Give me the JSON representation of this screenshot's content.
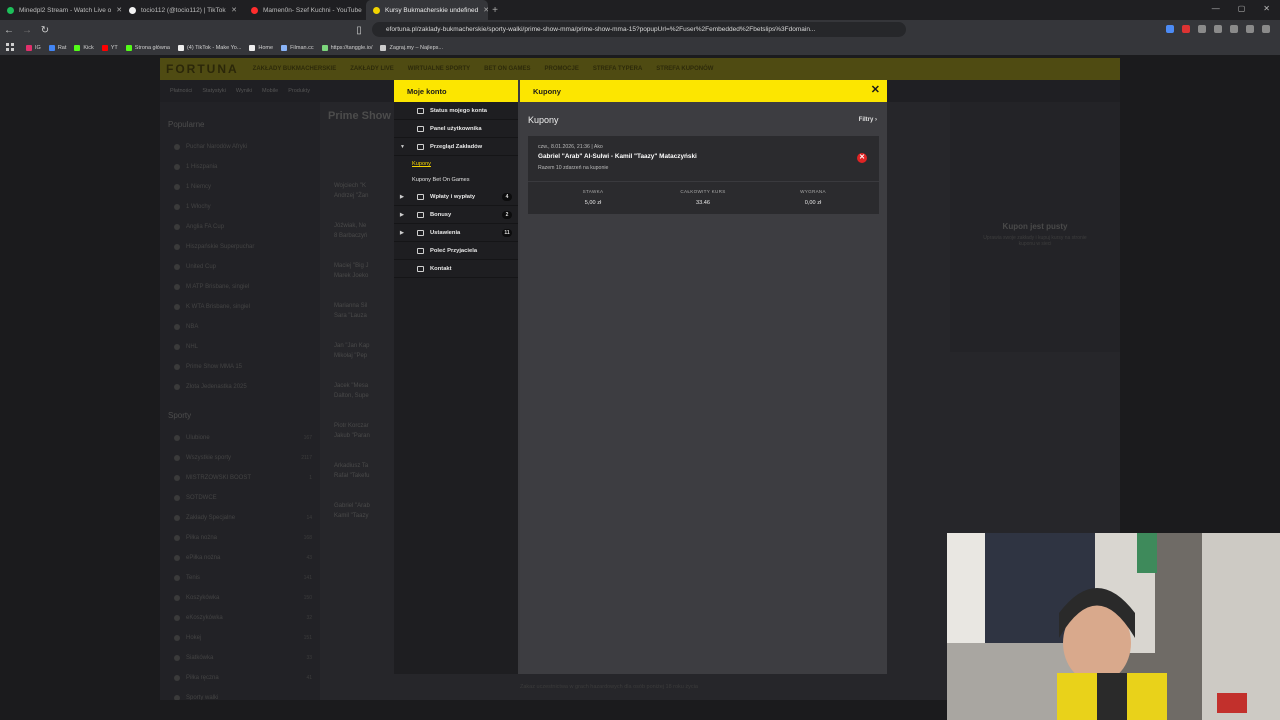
{
  "browser": {
    "tabs": [
      {
        "title": "Minedpl2 Stream - Watch Live o",
        "color": "#1dbf5a",
        "active": false
      },
      {
        "title": "tocio112 (@tocio112) | TikTok",
        "color": "#f2f2f2",
        "active": false
      },
      {
        "title": "Mamen0n- Szef Kuchni - YouTube",
        "color": "#ff2d2d",
        "active": false
      },
      {
        "title": "Kursy Bukmacherskie undefined",
        "color": "#f2d400",
        "active": true
      }
    ],
    "url": "efortuna.pl/zaklady-bukmacherskie/sporty-walki/prime-show-mma/prime-show-mma-15?popupUrl=%2Fuser%2Fembedded%2Fbetslips%3Fdomain...",
    "bookmarks": [
      {
        "label": "IG",
        "color": "#e1306c"
      },
      {
        "label": "Rat",
        "color": "#4285f4"
      },
      {
        "label": "Kick",
        "color": "#53fc18"
      },
      {
        "label": "YT",
        "color": "#ff0000"
      },
      {
        "label": "Strona główna",
        "color": "#53fc18"
      },
      {
        "label": "(4) TikTok - Make Yo...",
        "color": "#eeeeee"
      },
      {
        "label": "Home",
        "color": "#eeeeee"
      },
      {
        "label": "Filman.cc",
        "color": "#8ab4f8"
      },
      {
        "label": "https://tanggle.io/",
        "color": "#7cd67c"
      },
      {
        "label": "Zagraj.my – Najleps...",
        "color": "#cccccc"
      }
    ]
  },
  "site": {
    "logo": "FORTUNA",
    "nav": [
      "ZAKŁADY BUKMACHERSKIE",
      "ZAKŁADY LIVE",
      "WIRTUALNE SPORTY",
      "BET ON GAMES",
      "PROMOCJE",
      "STREFA TYPERA",
      "STREFA KUPONÓW"
    ],
    "subnav": [
      "Płatności",
      "Statystyki",
      "Wyniki",
      "Mobile",
      "Produkty"
    ],
    "popular_heading": "Popularne",
    "popular": [
      "Puchar Narodów Afryki",
      "1 Hiszpania",
      "1 Niemcy",
      "1 Włochy",
      "Anglia FA Cup",
      "Hiszpańskie Superpuchar",
      "United Cup",
      "M ATP Brisbane, singiel",
      "K WTA Brisbane, singiel",
      "NBA",
      "NHL",
      "Prime Show MMA 15",
      "Złota Jedenastka 2025"
    ],
    "sports_heading": "Sporty",
    "sports": [
      {
        "name": "Ulubione",
        "count": "167"
      },
      {
        "name": "Wszystkie sporty",
        "count": "2117"
      },
      {
        "name": "MISTRZOWSKI BOOST",
        "count": "1"
      },
      {
        "name": "SOTDWCE",
        "count": ""
      },
      {
        "name": "Zakłady Specjalne",
        "count": "14"
      },
      {
        "name": "Piłka nożna",
        "count": "168"
      },
      {
        "name": "ePiłka nożna",
        "count": "43"
      },
      {
        "name": "Tenis",
        "count": "141"
      },
      {
        "name": "Koszykówka",
        "count": "150"
      },
      {
        "name": "eKoszykówka",
        "count": "32"
      },
      {
        "name": "Hokej",
        "count": "151"
      },
      {
        "name": "Siatkówka",
        "count": "33"
      },
      {
        "name": "Piłka ręczna",
        "count": "41"
      },
      {
        "name": "Sporty walki",
        "count": ""
      }
    ],
    "event_title": "Prime Show",
    "fights": [
      "Wojciech \"K",
      "Andrzej \"Żan",
      "Jóźwiak, Ne",
      "8 Barbaczyń",
      "Maciej \"Big J",
      "Marek Joeko",
      "Marianna Sil",
      "Sara \"Lauza",
      "Jan \"Jan Kap",
      "Mikołaj \"Pep",
      "Jacek \"Mesa",
      "Dalton, Supe",
      "Piotr Korczar",
      "Jakub \"Paran",
      "Arkadiusz Ta",
      "Rafał \"Takefu",
      "Gabriel \"Arab",
      "Kamil \"Taazy"
    ],
    "empty_coupon": "Kupon jest pusty",
    "empty_coupon_sub": "Uprawia swoje zakłady i kupuj kursy na stronie kuponu w sieci",
    "bottom_note": "Zakaz uczestnictwa w grach hazardowych dla osób poniżej 18 roku życia"
  },
  "modal": {
    "side_title": "Moje konto",
    "main_title": "Kupony",
    "menu": [
      {
        "label": "Status mojego konta",
        "icon": "info-icon",
        "arrow": "",
        "badge": ""
      },
      {
        "label": "Panel użytkownika",
        "icon": "panel-icon",
        "arrow": "",
        "badge": ""
      },
      {
        "label": "Przegląd Zakładów",
        "icon": "document-icon",
        "arrow": "▼",
        "badge": ""
      }
    ],
    "submenu": [
      {
        "label": "Kupony",
        "active": true
      },
      {
        "label": "Kupony Bet On Games",
        "active": false
      }
    ],
    "menu2": [
      {
        "label": "Wpłaty i wypłaty",
        "icon": "wallet-icon",
        "arrow": "▶",
        "badge": "4"
      },
      {
        "label": "Bonusy",
        "icon": "gift-icon",
        "arrow": "▶",
        "badge": "2"
      },
      {
        "label": "Ustawienia",
        "icon": "settings-icon",
        "arrow": "▶",
        "badge": "11"
      },
      {
        "label": "Poleć Przyjaciela",
        "icon": "friend-icon",
        "arrow": "",
        "badge": ""
      },
      {
        "label": "Kontakt",
        "icon": "mail-icon",
        "arrow": "",
        "badge": ""
      }
    ],
    "content_title": "Kupony",
    "filter_label": "Filtry",
    "coupon": {
      "date": "czw., 8.01.2026, 21:36 | Ako",
      "title": "Gabriel \"Arab\" Al-Sulwi - Kamil \"Taazy\" Mataczyński",
      "subtitle": "Razem 10 zdarzeń na kuponie",
      "stake_label": "STAWKA",
      "stake_value": "5,00 zł",
      "odds_label": "CAŁKOWITY KURS",
      "odds_value": "33.46",
      "win_label": "WYGRANA",
      "win_value": "0,00 zł"
    }
  }
}
